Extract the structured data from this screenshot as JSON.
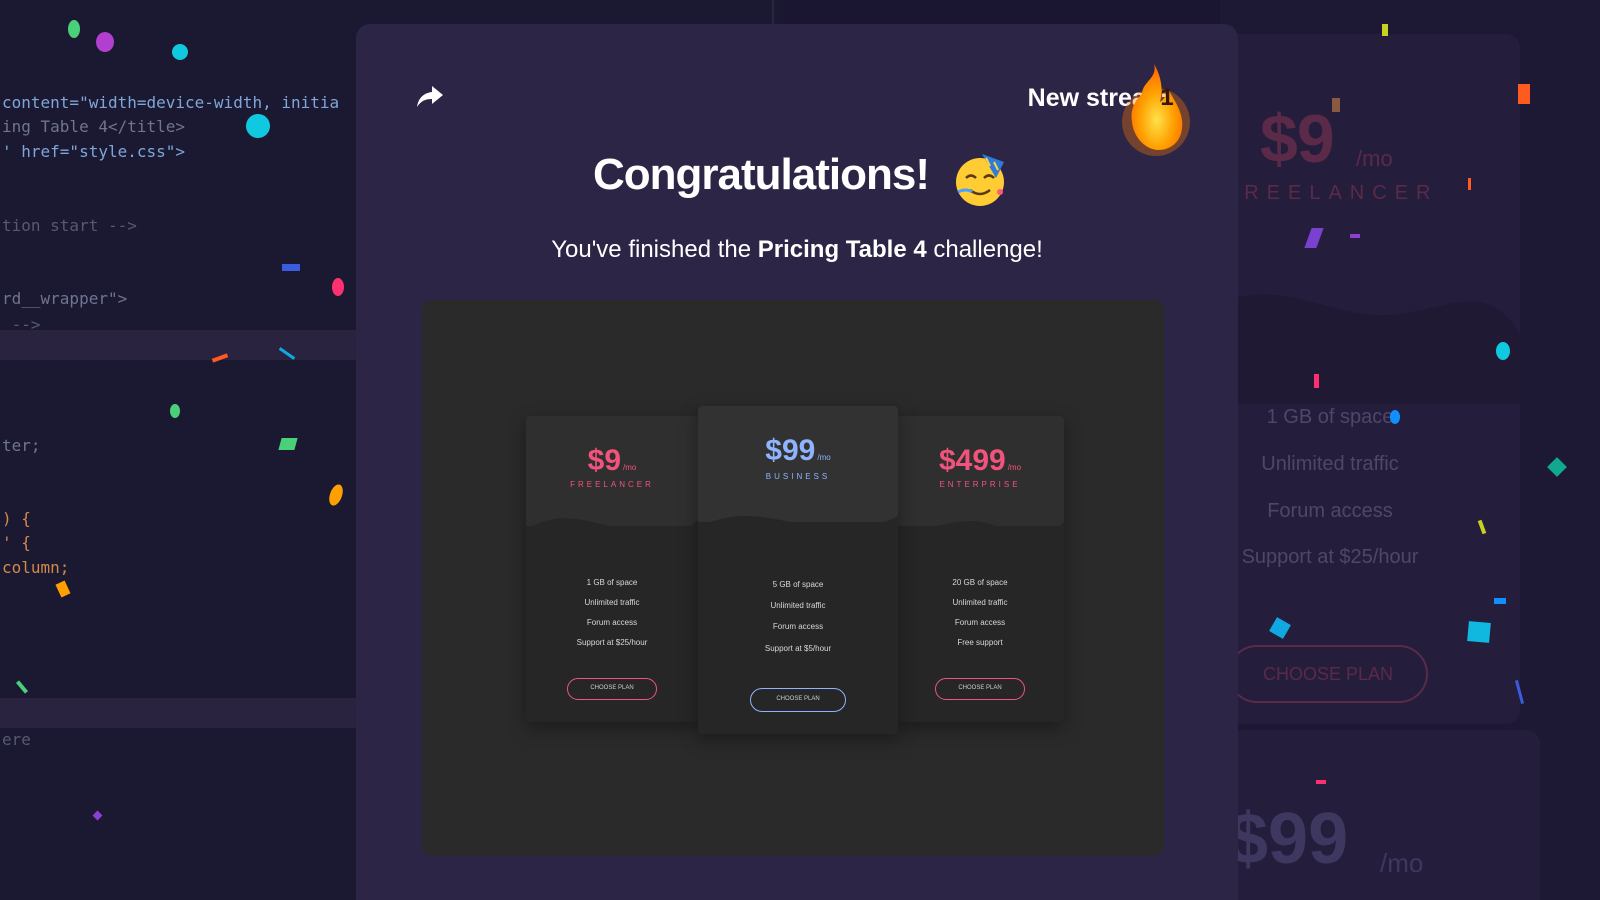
{
  "editor": {
    "lines": [
      {
        "text": "content=\"width=device-width, initia",
        "kind": "attr"
      },
      {
        "text": "ing Table 4</title>",
        "kind": "tag"
      },
      {
        "text": "' href=\"style.css\">",
        "kind": "attr"
      },
      {
        "text": "tion start -->",
        "kind": "comment"
      },
      {
        "text": "rd__wrapper\">",
        "kind": "tag"
      },
      {
        "text": " -->",
        "kind": "comment"
      },
      {
        "text": "ter;",
        "kind": "tag"
      },
      {
        "text": ") {",
        "kind": "orange"
      },
      {
        "text": "' {",
        "kind": "orange"
      },
      {
        "text": "column;",
        "kind": "orange"
      },
      {
        "text": "ere",
        "kind": "comment"
      }
    ]
  },
  "modal": {
    "streak_label": "New streak:",
    "streak_count": "1",
    "title": "Congratulations!",
    "subtitle_prefix": "You've finished the ",
    "subtitle_challenge": "Pricing Table 4",
    "subtitle_suffix": " challenge!",
    "icons": {
      "share": "share-icon",
      "streak": "flame-icon",
      "celebration": "party-face-icon"
    }
  },
  "screenshot": {
    "cards": [
      {
        "price": "$9",
        "per": "/mo",
        "plan": "FREELANCER",
        "color": "#f2537d",
        "features": [
          "1 GB of space",
          "Unlimited traffic",
          "Forum access",
          "Support at $25/hour"
        ],
        "button": "CHOOSE PLAN"
      },
      {
        "price": "$99",
        "per": "/mo",
        "plan": "BUSINESS",
        "color": "#8fb3ff",
        "features": [
          "5 GB of space",
          "Unlimited traffic",
          "Forum access",
          "Support at $5/hour"
        ],
        "button": "CHOOSE PLAN"
      },
      {
        "price": "$499",
        "per": "/mo",
        "plan": "ENTERPRISE",
        "color": "#f2537d",
        "features": [
          "20 GB of space",
          "Unlimited traffic",
          "Forum access",
          "Free support"
        ],
        "button": "CHOOSE PLAN"
      }
    ]
  },
  "preview": {
    "card1": {
      "price": "$9",
      "per": "/mo",
      "plan": "FREELANCER",
      "features": [
        "1 GB of space",
        "Unlimited traffic",
        "Forum access",
        "Support at $25/hour"
      ],
      "button": "CHOOSE PLAN"
    },
    "card2": {
      "price": "$99",
      "per": "/mo"
    }
  },
  "colors": {
    "background": "#1a1530",
    "modal": "#2c2546",
    "accent_pink": "#f2537d",
    "accent_blue": "#8fb3ff",
    "flame": "#ff8a00"
  }
}
